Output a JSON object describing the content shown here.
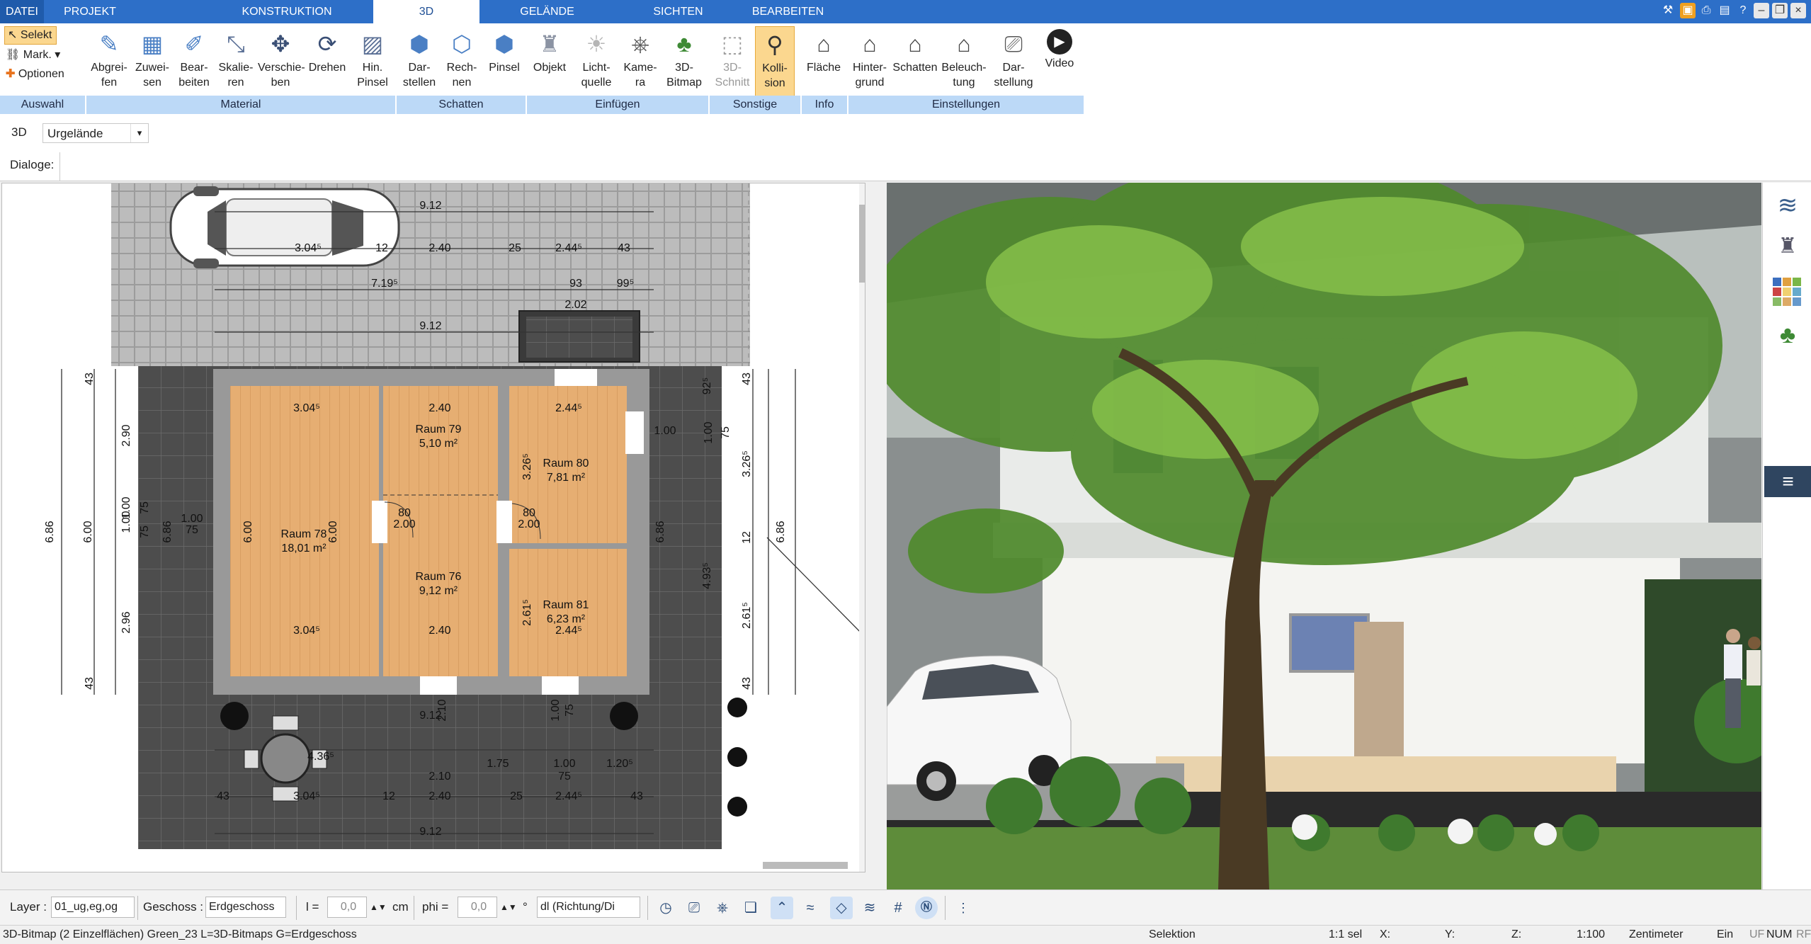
{
  "tabs": [
    {
      "label": "DATEI"
    },
    {
      "label": "PROJEKT"
    },
    {
      "label": "KONSTRUKTION"
    },
    {
      "label": "3D"
    },
    {
      "label": "GELÄNDE"
    },
    {
      "label": "SICHTEN"
    },
    {
      "label": "BEARBEITEN"
    }
  ],
  "selection_tools": {
    "select": "Selekt",
    "mark": "Mark.",
    "options": "Optionen"
  },
  "ribbon_buttons": [
    {
      "label1": "Abgrei-",
      "label2": "fen",
      "icon": "eyedropper-icon"
    },
    {
      "label1": "Zuwei-",
      "label2": "sen",
      "icon": "assign-material-icon"
    },
    {
      "label1": "Bear-",
      "label2": "beiten",
      "icon": "edit-material-icon"
    },
    {
      "label1": "Skalie-",
      "label2": "ren",
      "icon": "scale-icon"
    },
    {
      "label1": "Verschie-",
      "label2": "ben",
      "icon": "move-icon"
    },
    {
      "label1": "Drehen",
      "label2": "",
      "icon": "rotate-icon"
    },
    {
      "label1": "Hin.",
      "label2": "Pinsel",
      "icon": "brush-icon"
    },
    {
      "label1": "Dar-",
      "label2": "stellen",
      "icon": "shade-cube-icon"
    },
    {
      "label1": "Rech-",
      "label2": "nen",
      "icon": "compute-shadow-icon"
    },
    {
      "label1": "Pinsel",
      "label2": "",
      "icon": "shadow-brush-icon"
    },
    {
      "label1": "Objekt",
      "label2": "",
      "icon": "chair-icon"
    },
    {
      "label1": "Licht-",
      "label2": "quelle",
      "icon": "lightbulb-icon"
    },
    {
      "label1": "Kame-",
      "label2": "ra",
      "icon": "camera-icon"
    },
    {
      "label1": "3D-",
      "label2": "Bitmap",
      "icon": "tree-icon"
    },
    {
      "label1": "3D-",
      "label2": "Schnitt",
      "icon": "section-icon"
    },
    {
      "label1": "Kolli-",
      "label2": "sion",
      "icon": "collision-person-icon"
    },
    {
      "label1": "Fläche",
      "label2": "",
      "icon": "area-info-icon"
    },
    {
      "label1": "Hinter-",
      "label2": "grund",
      "icon": "background-house-icon"
    },
    {
      "label1": "Schatten",
      "label2": "",
      "icon": "shadow-house-icon"
    },
    {
      "label1": "Beleuch-",
      "label2": "tung",
      "icon": "lighting-house-icon"
    },
    {
      "label1": "Dar-",
      "label2": "stellung",
      "icon": "display-monitor-icon"
    },
    {
      "label1": "Video",
      "label2": "",
      "icon": "play-icon"
    }
  ],
  "ribbon_groups": {
    "auswahl": "Auswahl",
    "material": "Material",
    "schatten": "Schatten",
    "einfuegen": "Einfügen",
    "sonstige": "Sonstige",
    "info": "Info",
    "einstellungen": "Einstellungen"
  },
  "bar1": {
    "mode": "3D",
    "terrain_select": "Urgelände"
  },
  "bar2": {
    "dialoge": "Dialoge:"
  },
  "plan": {
    "rooms": [
      {
        "name": "Raum 78",
        "area": "18,01 m²"
      },
      {
        "name": "Raum 79",
        "area": "5,10 m²"
      },
      {
        "name": "Raum 80",
        "area": "7,81 m²"
      },
      {
        "name": "Raum 76",
        "area": "9,12 m²"
      },
      {
        "name": "Raum 81",
        "area": "6,23 m²"
      }
    ],
    "dims_top": [
      "9.12",
      "3.04⁵",
      "2.40",
      "2.44⁵",
      "43",
      "12",
      "25",
      "7.19⁵",
      "93",
      "99⁵",
      "2.02",
      "9.12"
    ],
    "dims_inner": [
      "3.04⁵",
      "2.40",
      "2.44⁵",
      "3.04⁵",
      "2.40",
      "2.44⁵",
      "6.00",
      "6.00",
      "3.26⁵",
      "2.61⁵",
      "80",
      "2.00",
      "2.00",
      "80",
      "1.00",
      "75"
    ],
    "dims_left": [
      "43",
      "2.90",
      "6.86",
      "6.00",
      "1.00",
      "75",
      "6.86",
      "2.96",
      "43",
      "1.00",
      "75"
    ],
    "dims_right": [
      "43",
      "92⁵",
      "1.00",
      "75",
      "1.00",
      "3.26⁵",
      "6.86",
      "12",
      "4.93⁵",
      "6.86",
      "2.61⁵",
      "43"
    ],
    "dims_bottom": [
      "9.12",
      "2.10",
      "1.00",
      "75",
      "1.75",
      "1.00",
      "75",
      "1.20⁵",
      "2.10",
      "4.36⁵",
      "3.04⁵",
      "2.40",
      "2.44⁵",
      "43",
      "12",
      "25",
      "43",
      "9.12"
    ]
  },
  "bottom_bar": {
    "layer_label": "Layer :",
    "layer_value": "01_ug,eg,og",
    "geschoss_label": "Geschoss :",
    "geschoss_value": "Erdgeschoss",
    "l_label": "l =",
    "l_value": "0,0",
    "l_unit": "cm",
    "phi_label": "phi =",
    "phi_value": "0,0",
    "phi_unit": "°",
    "direction_value": "dl (Richtung/Di"
  },
  "status": {
    "info": "3D-Bitmap (2 Einzelflächen) Green_23 L=3D-Bitmaps G=Erdgeschoss",
    "mode": "Selektion",
    "sel": "1:1 sel",
    "x": "X:",
    "y": "Y:",
    "z": "Z:",
    "scale": "1:100",
    "unit": "Zentimeter",
    "ein": "Ein",
    "uf": "UF",
    "num": "NUM",
    "rf": "RF"
  },
  "colors": {
    "accent": "#2d6fc8",
    "group_bg": "#bcd9f7",
    "selected": "#fbd78f",
    "floor": "#e3ad70",
    "paving": "#5a5a5a"
  }
}
